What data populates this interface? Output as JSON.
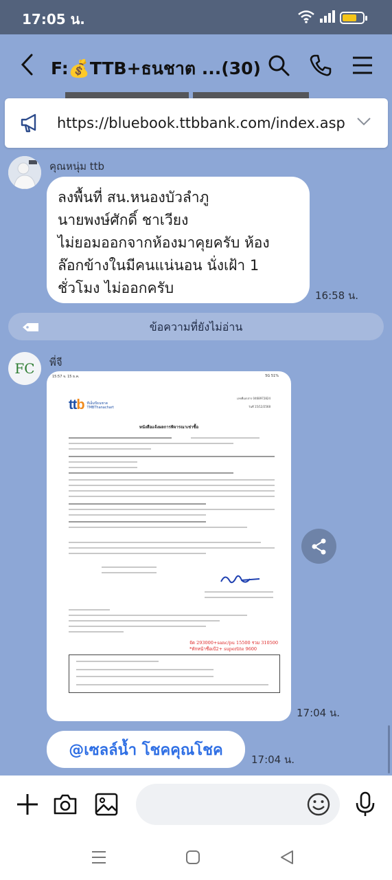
{
  "status_bar": {
    "time": "17:05 น.",
    "battery_level": 0.7
  },
  "header": {
    "title": "F:💰TTB+ธนชาต ...(30)"
  },
  "announcement": {
    "url": "https://bluebook.ttbbank.com/index.asp"
  },
  "messages": [
    {
      "sender": "คุณหนุ่ม ttb",
      "lines": [
        "ลงพื้นที่ สน.หนองบัวลำภู",
        "นายพงษ์ศักดิ์ ชาเวียง",
        "ไม่ยอมออกจากห้องมาคุยครับ ห้อง",
        "ล๊อกข้างในมีคนแน่นอน นั่งเฝ้า 1",
        "ชั่วโมง ไม่ออกครับ"
      ],
      "time": "16:58 น."
    },
    {
      "sender": "พี่จี",
      "avatar_text": "FC",
      "image": {
        "status_left": "15:57  จ. 15 ธ.ค.",
        "status_right": "5G 51%",
        "logo": "ttb",
        "logo_sub_1": "ทีเอ็มบีธนชาต",
        "logo_sub_2": "TMBThanachart",
        "ref_no": "เลขที่เอกสาร 0468972824",
        "date": "วันที่ 15/12/2568",
        "doc_title": "หนังสือแจ้งผลการพิจารณาเช่าซื้อ",
        "red_note_1": "จัด 293000+sanc/pu 15500 รวม 310500",
        "red_note_2": "*ทักหน้าชื่อเป้2+ superlite 9600"
      },
      "time": "17:04 น."
    },
    {
      "mention": "@เซลล์น้ำ โชคคุณโชค",
      "time": "17:04 น."
    }
  ],
  "unread_divider": "ข้อความที่ยังไม่อ่าน",
  "input": {
    "placeholder": ""
  },
  "colors": {
    "chat_bg": "#8DA7D6",
    "mention": "#2F6FE4",
    "status_bg": "#53627C"
  }
}
